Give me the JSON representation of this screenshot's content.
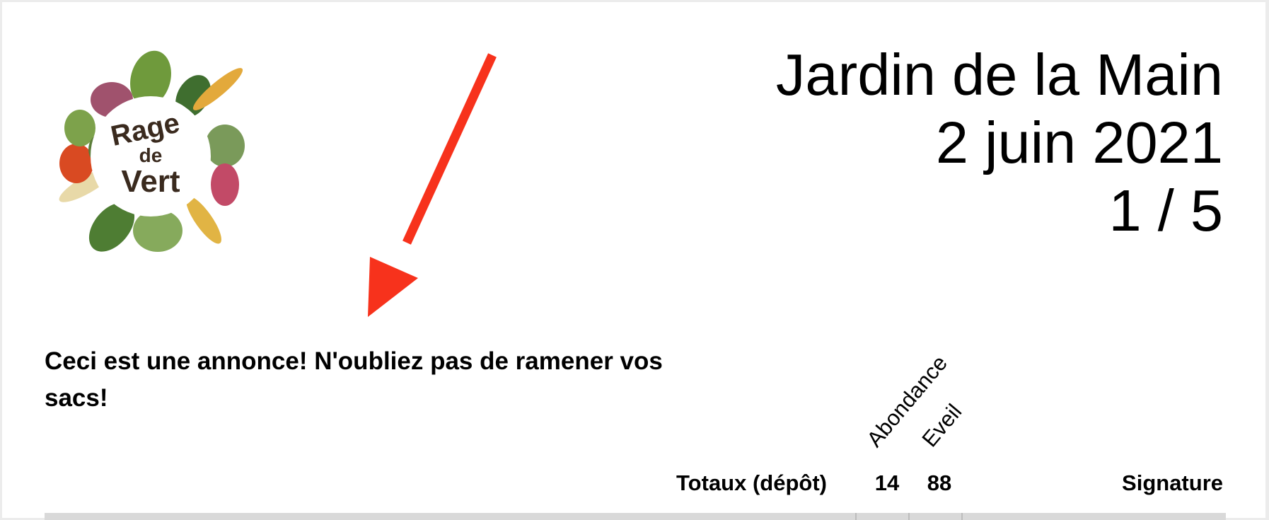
{
  "logo": {
    "text_line1": "Rage",
    "text_line2": "de",
    "text_line3": "Vert",
    "icon": "vegetable-wreath-logo"
  },
  "header": {
    "site": "Jardin de la Main",
    "date": "2 juin 2021",
    "page": "1 / 5"
  },
  "annotation": {
    "icon": "red-arrow-icon",
    "color": "#f7321c"
  },
  "announcement": "Ceci est une annonce! N'oubliez pas de ramener vos sacs!",
  "table": {
    "columns": [
      "Abondance",
      "Eveil"
    ],
    "totals_label": "Totaux (dépôt)",
    "totals": [
      "14",
      "88"
    ],
    "signature_label": "Signature"
  }
}
